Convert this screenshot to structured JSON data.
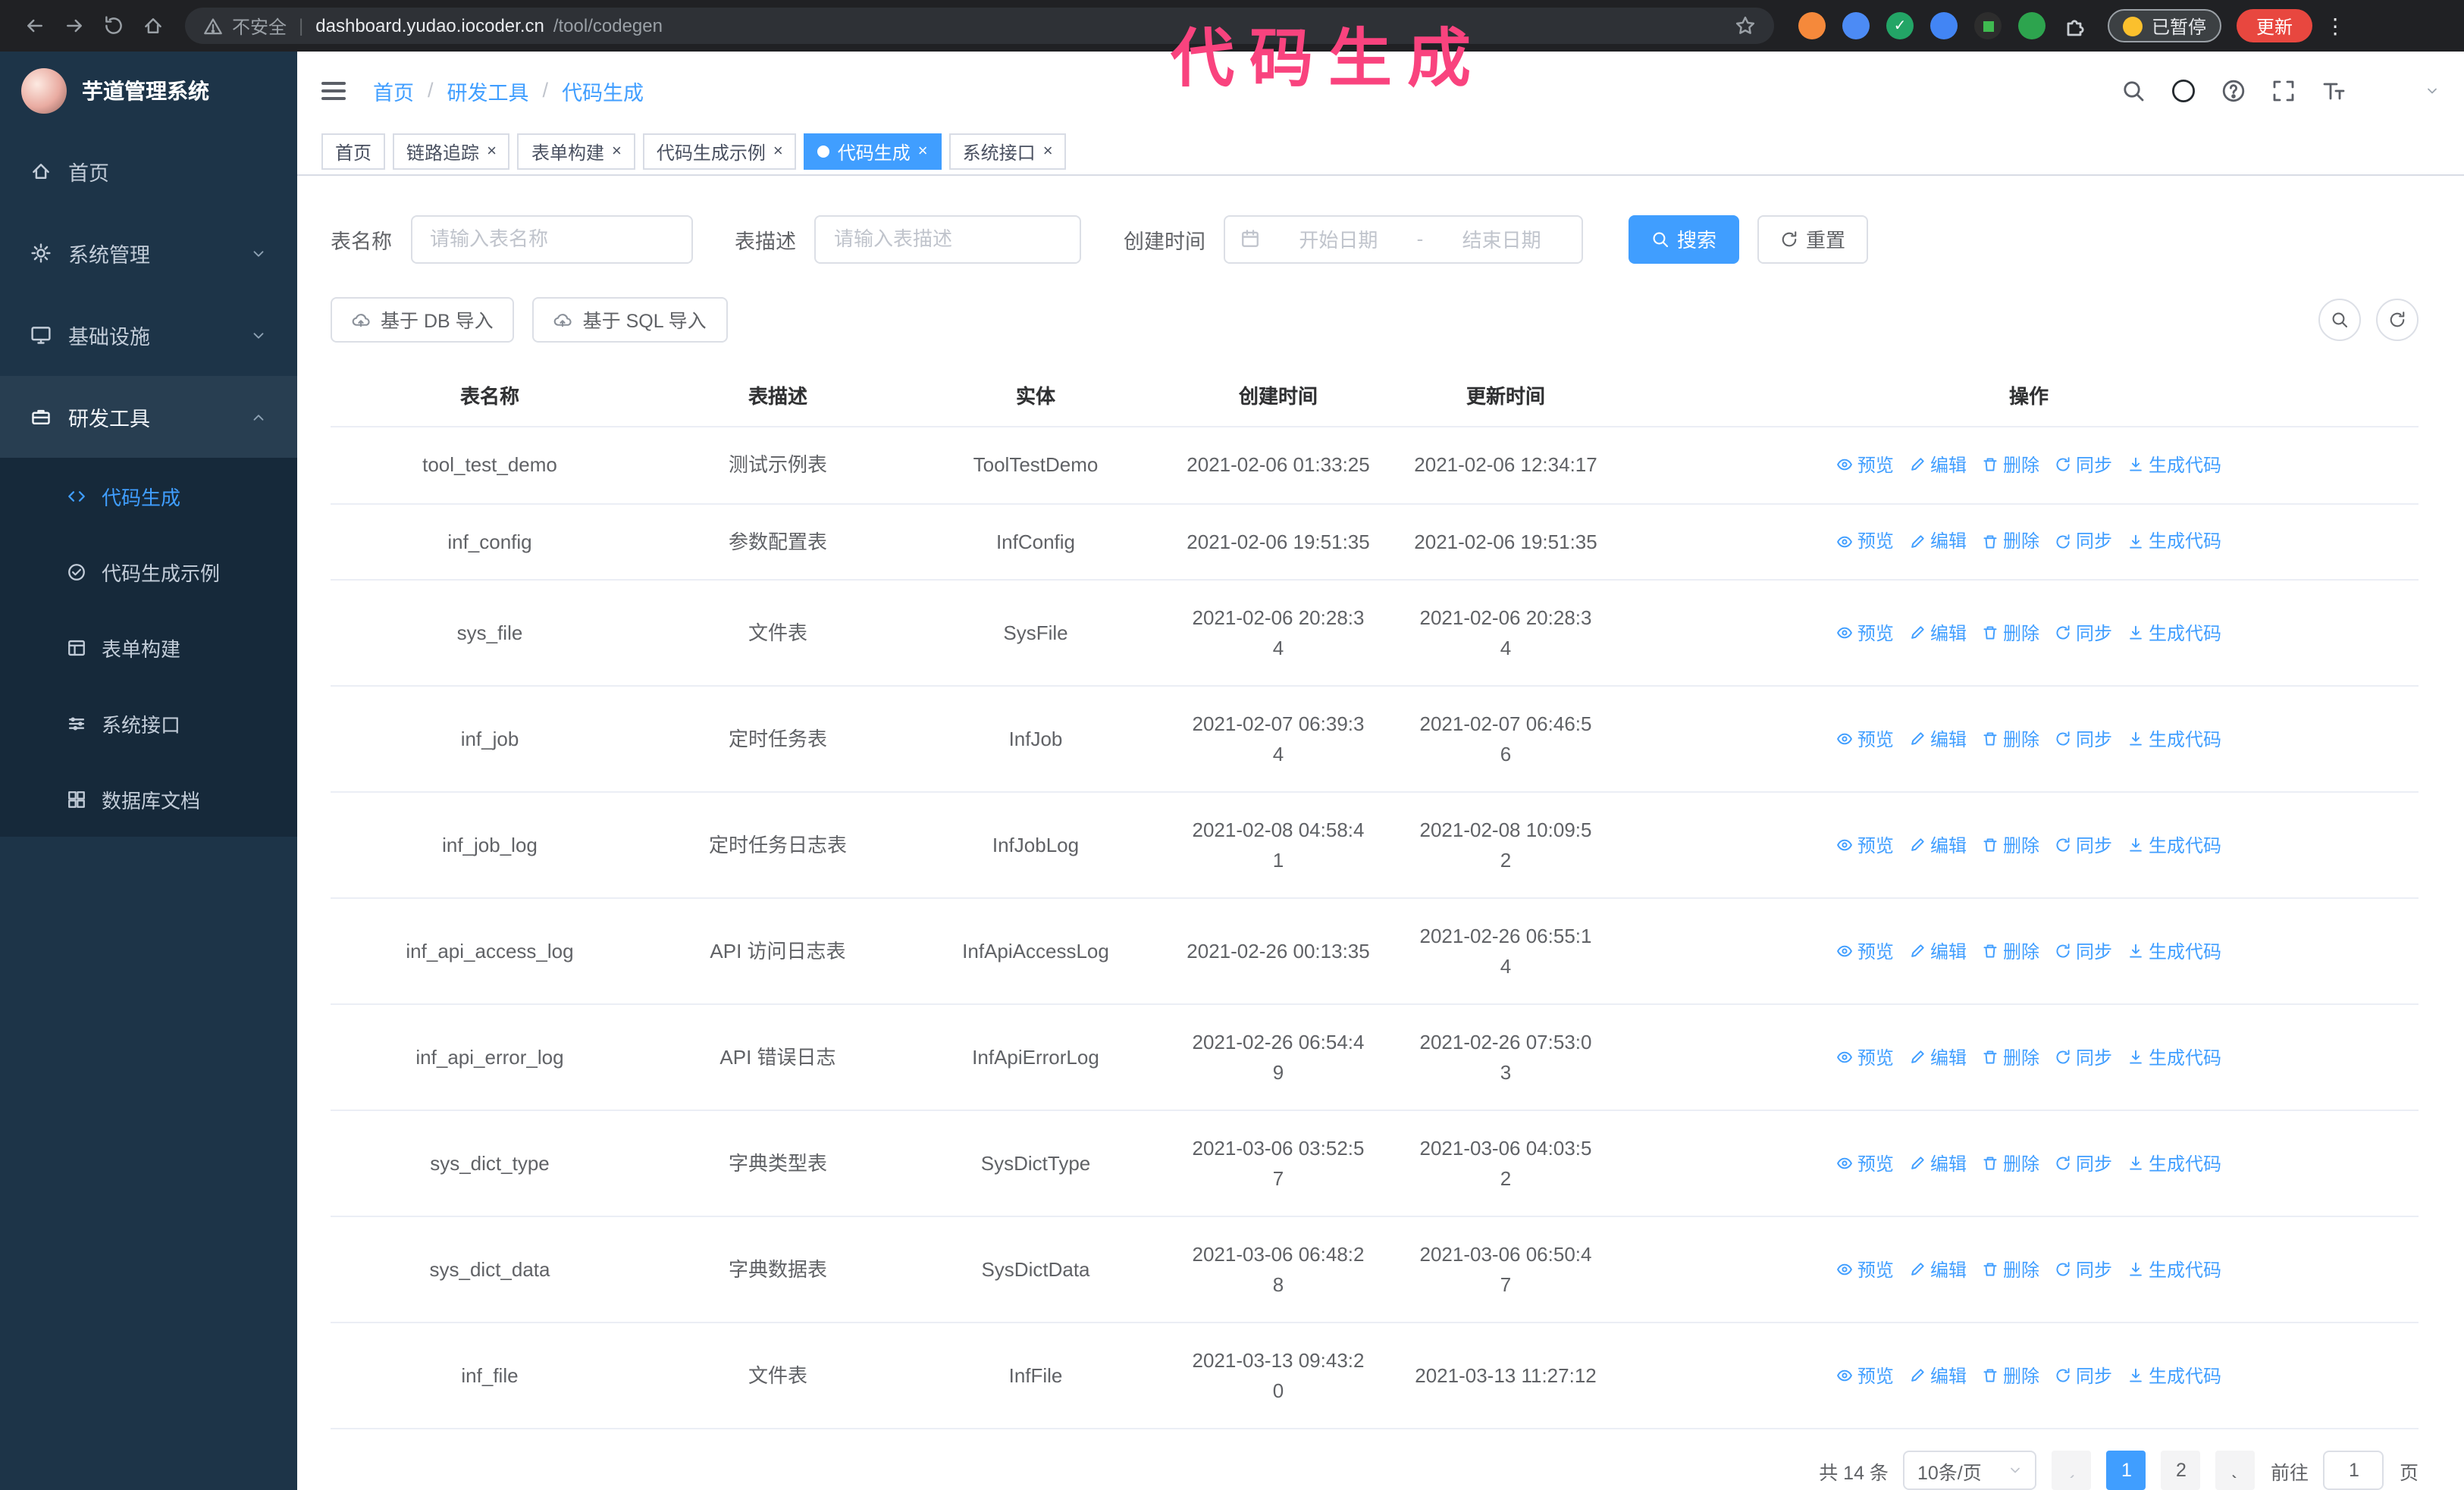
{
  "colors": {
    "primary": "#409eff",
    "annotation_pink": "#f9437e",
    "sidebar_bg": "#1d3448"
  },
  "icons": {
    "close": "×",
    "separator": "/",
    "pipe": "|",
    "ellipsis": "⋮",
    "check": "✓",
    "star": "☆"
  },
  "annotation": {
    "text": "代码生成"
  },
  "browser": {
    "security_label": "不安全",
    "url_domain": "dashboard.yudao.iocoder.cn",
    "url_path": "/tool/codegen",
    "paused_badge": "已暂停",
    "update_button": "更新"
  },
  "sidebar": {
    "logo_title": "芋道管理系统",
    "items": [
      {
        "label": "首页"
      },
      {
        "label": "系统管理"
      },
      {
        "label": "基础设施"
      },
      {
        "label": "研发工具"
      }
    ],
    "subitems": [
      {
        "label": "代码生成"
      },
      {
        "label": "代码生成示例"
      },
      {
        "label": "表单构建"
      },
      {
        "label": "系统接口"
      },
      {
        "label": "数据库文档"
      }
    ]
  },
  "header": {
    "breadcrumb": [
      "首页",
      "研发工具",
      "代码生成"
    ]
  },
  "tabs": [
    {
      "label": "首页"
    },
    {
      "label": "链路追踪"
    },
    {
      "label": "表单构建"
    },
    {
      "label": "代码生成示例"
    },
    {
      "label": "代码生成"
    },
    {
      "label": "系统接口"
    }
  ],
  "filters": {
    "table_name_label": "表名称",
    "table_name_placeholder": "请输入表名称",
    "table_desc_label": "表描述",
    "table_desc_placeholder": "请输入表描述",
    "create_time_label": "创建时间",
    "date_start_placeholder": "开始日期",
    "date_separator": "-",
    "date_end_placeholder": "结束日期",
    "search_button": "搜索",
    "reset_button": "重置"
  },
  "toolbar": {
    "import_db": "基于 DB 导入",
    "import_sql": "基于 SQL 导入"
  },
  "table": {
    "columns": [
      "表名称",
      "表描述",
      "实体",
      "创建时间",
      "更新时间",
      "操作"
    ],
    "actions": [
      "预览",
      "编辑",
      "删除",
      "同步",
      "生成代码"
    ],
    "rows": [
      {
        "name": "tool_test_demo",
        "desc": "测试示例表",
        "entity": "ToolTestDemo",
        "created": "2021-02-06 01:33:25",
        "updated": "2021-02-06 12:34:17"
      },
      {
        "name": "inf_config",
        "desc": "参数配置表",
        "entity": "InfConfig",
        "created": "2021-02-06 19:51:35",
        "updated": "2021-02-06 19:51:35"
      },
      {
        "name": "sys_file",
        "desc": "文件表",
        "entity": "SysFile",
        "created": "2021-02-06 20:28:3\n4",
        "updated": "2021-02-06 20:28:3\n4"
      },
      {
        "name": "inf_job",
        "desc": "定时任务表",
        "entity": "InfJob",
        "created": "2021-02-07 06:39:3\n4",
        "updated": "2021-02-07 06:46:5\n6"
      },
      {
        "name": "inf_job_log",
        "desc": "定时任务日志表",
        "entity": "InfJobLog",
        "created": "2021-02-08 04:58:4\n1",
        "updated": "2021-02-08 10:09:5\n2"
      },
      {
        "name": "inf_api_access_log",
        "desc": "API 访问日志表",
        "entity": "InfApiAccessLog",
        "created": "2021-02-26 00:13:35",
        "updated": "2021-02-26 06:55:1\n4"
      },
      {
        "name": "inf_api_error_log",
        "desc": "API 错误日志",
        "entity": "InfApiErrorLog",
        "created": "2021-02-26 06:54:4\n9",
        "updated": "2021-02-26 07:53:0\n3"
      },
      {
        "name": "sys_dict_type",
        "desc": "字典类型表",
        "entity": "SysDictType",
        "created": "2021-03-06 03:52:5\n7",
        "updated": "2021-03-06 04:03:5\n2"
      },
      {
        "name": "sys_dict_data",
        "desc": "字典数据表",
        "entity": "SysDictData",
        "created": "2021-03-06 06:48:2\n8",
        "updated": "2021-03-06 06:50:4\n7"
      },
      {
        "name": "inf_file",
        "desc": "文件表",
        "entity": "InfFile",
        "created": "2021-03-13 09:43:2\n0",
        "updated": "2021-03-13 11:27:12"
      }
    ]
  },
  "pagination": {
    "total": "共 14 条",
    "page_size": "10条/页",
    "pages": [
      "1",
      "2"
    ],
    "goto_label": "前往",
    "goto_value": "1",
    "goto_suffix": "页"
  }
}
